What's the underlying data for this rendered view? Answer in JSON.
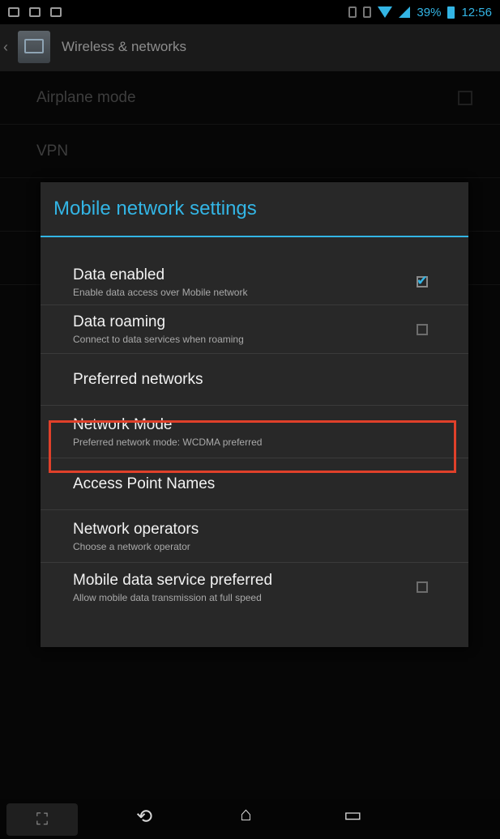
{
  "status_bar": {
    "left_icons": [
      "screenshot-icon",
      "message-icon",
      "photo-icon"
    ],
    "right_icons": [
      "vibrate-icon",
      "sync-icon",
      "wifi-icon",
      "signal-icon"
    ],
    "battery": "39%",
    "time": "12:56"
  },
  "action_bar": {
    "title": "Wireless & networks"
  },
  "background_list": {
    "items": [
      {
        "label": "Airplane mode"
      },
      {
        "label": "VPN"
      },
      {
        "label": ""
      },
      {
        "label": ""
      }
    ]
  },
  "dialog": {
    "title": "Mobile network settings",
    "items": [
      {
        "title": "Data enabled",
        "summary": "Enable data access over Mobile network",
        "checked": true
      },
      {
        "title": "Data roaming",
        "summary": "Connect to data services when roaming",
        "checked": false
      },
      {
        "title": "Preferred networks",
        "summary": ""
      },
      {
        "title": "Network Mode",
        "summary": "Preferred network mode: WCDMA preferred"
      },
      {
        "title": "Access Point Names",
        "summary": ""
      },
      {
        "title": "Network operators",
        "summary": "Choose a network operator"
      },
      {
        "title": "Mobile data service preferred",
        "summary": "Allow mobile data transmission at full speed",
        "checked": false
      }
    ]
  },
  "colors": {
    "accent": "#33b5e5",
    "highlight": "#e0402a"
  }
}
